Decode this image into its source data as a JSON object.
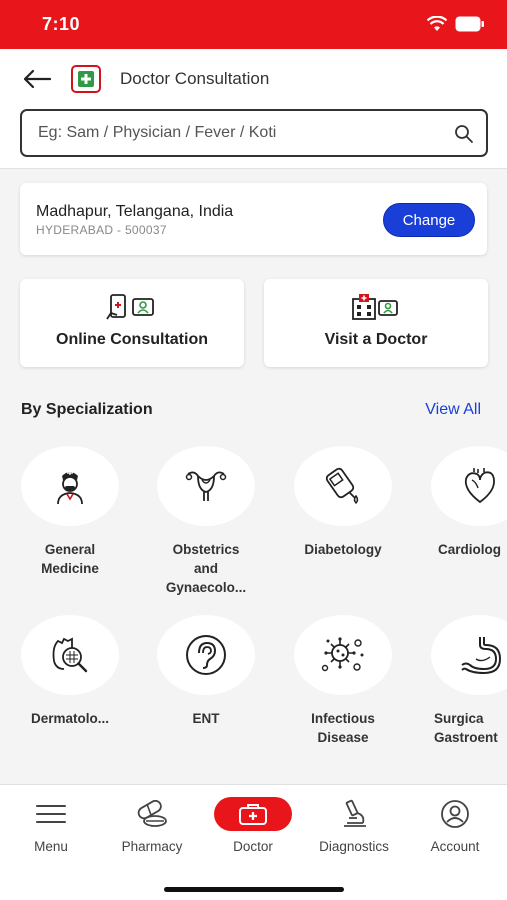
{
  "status_bar": {
    "time": "7:10"
  },
  "header": {
    "title": "Doctor Consultation",
    "search_placeholder": "Eg: Sam / Physician / Fever / Koti"
  },
  "location": {
    "name": "Madhapur, Telangana, India",
    "sub": "HYDERABAD - 500037",
    "change_label": "Change"
  },
  "actions": {
    "online": "Online Consultation",
    "visit": "Visit a Doctor"
  },
  "specialization": {
    "title": "By Specialization",
    "view_all": "View All",
    "items": [
      {
        "label": "General\nMedicine",
        "icon": "doctor-icon"
      },
      {
        "label": "Obstetrics\nand\nGynaecolo...",
        "icon": "uterus-icon"
      },
      {
        "label": "Diabetology",
        "icon": "glucometer-icon"
      },
      {
        "label": "Cardiolog",
        "icon": "heart-icon"
      },
      {
        "label": "Dermatolo...",
        "icon": "skin-magnifier-icon"
      },
      {
        "label": "ENT",
        "icon": "ear-icon"
      },
      {
        "label": "Infectious\nDisease",
        "icon": "virus-icon"
      },
      {
        "label": "Surgica\nGastroent",
        "icon": "stomach-icon"
      }
    ]
  },
  "bottom_nav": {
    "items": [
      {
        "label": "Menu",
        "icon": "menu-icon"
      },
      {
        "label": "Pharmacy",
        "icon": "pills-icon"
      },
      {
        "label": "Doctor",
        "icon": "medical-kit-icon"
      },
      {
        "label": "Diagnostics",
        "icon": "microscope-icon"
      },
      {
        "label": "Account",
        "icon": "account-icon"
      }
    ],
    "active": "Doctor"
  },
  "colors": {
    "brand_red": "#e8161b",
    "accent_blue": "#1a3fd9"
  }
}
